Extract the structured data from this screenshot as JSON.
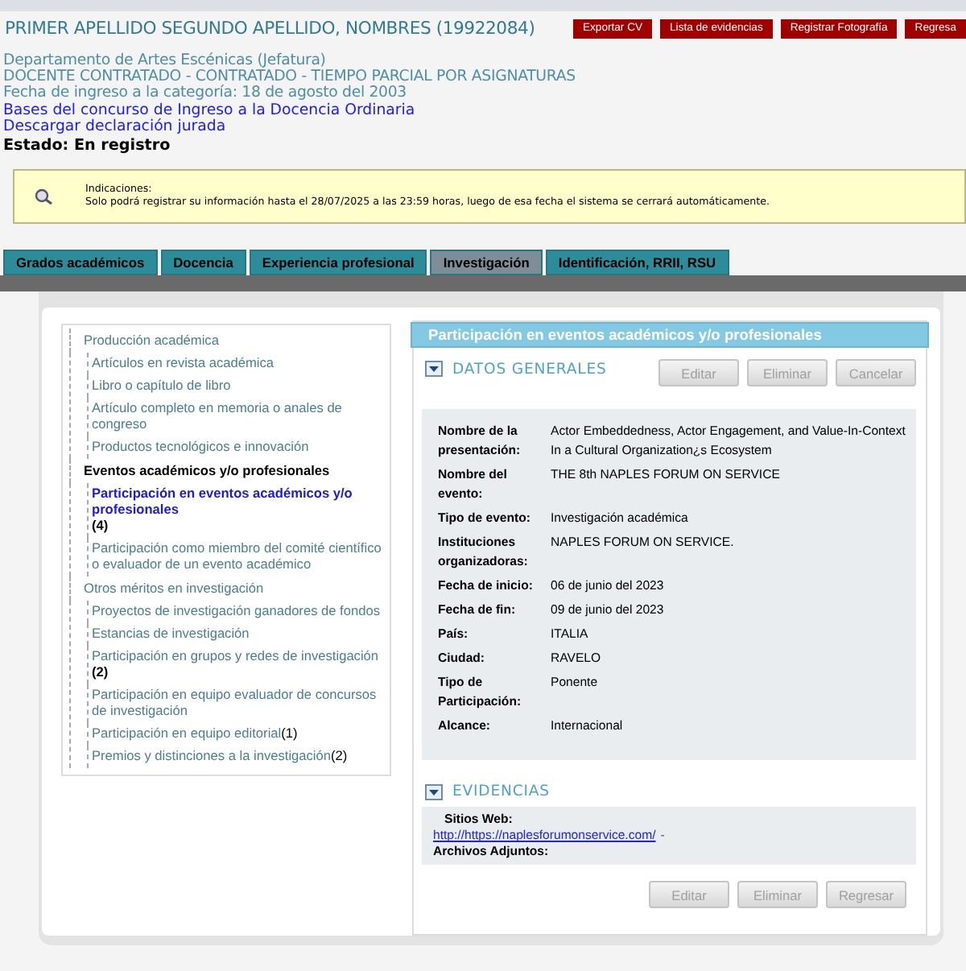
{
  "header": {
    "title": "PRIMER APELLIDO SEGUNDO APELLIDO, NOMBRES (19922084)",
    "buttons": [
      "Exportar CV",
      "Lista de evidencias",
      "Registrar Fotografía",
      "Regresa"
    ]
  },
  "profile": {
    "lines": [
      "Departamento de Artes Escénicas (Jefatura)",
      "DOCENTE CONTRATADO - CONTRATADO - TIEMPO PARCIAL POR ASIGNATURAS",
      "Fecha de ingreso a la categoría: 18 de agosto del 2003"
    ],
    "links": [
      "Bases del concurso de Ingreso a la Docencia Ordinaria",
      "Descargar declaración jurada"
    ],
    "status": "Estado: En registro"
  },
  "notice": {
    "title": "Indicaciones:",
    "text": "Solo podrá registrar su información hasta el 28/07/2025 a las 23:59 horas, luego de esa fecha el sistema se cerrará automáticamente."
  },
  "tabs": [
    {
      "label": "Grados académicos",
      "selected": false
    },
    {
      "label": "Docencia",
      "selected": false
    },
    {
      "label": "Experiencia profesional",
      "selected": false
    },
    {
      "label": "Investigación",
      "selected": true
    },
    {
      "label": "Identificación, RRII, RSU",
      "selected": false
    }
  ],
  "tree": [
    {
      "label": "Producción académica",
      "selected": false,
      "children": [
        {
          "label": "Artículos en revista académica",
          "selected": false
        },
        {
          "label": "Libro o capítulo de libro",
          "selected": false
        },
        {
          "label": "Artículo completo en memoria o anales de congreso",
          "selected": false
        },
        {
          "label": "Productos tecnológicos e innovación",
          "selected": false
        }
      ]
    },
    {
      "label": "Eventos académicos y/o profesionales",
      "selected": true,
      "children": [
        {
          "label": "Participación en eventos académicos y/o profesionales",
          "count": "(4)",
          "kind": "count_below",
          "selected": true
        },
        {
          "label": "Participación como miembro del comité científico o evaluador de un evento académico",
          "selected": false
        }
      ]
    },
    {
      "label": "Otros méritos en investigación",
      "selected": false,
      "children": [
        {
          "label": "Proyectos de investigación ganadores de fondos",
          "selected": false
        },
        {
          "label": "Estancias de investigación",
          "selected": false
        },
        {
          "label": "Participación en grupos y redes de investigación",
          "count": "(2)",
          "kind": "count_below",
          "selected": false
        },
        {
          "label": "Participación en equipo evaluador de concursos de investigación",
          "selected": false
        },
        {
          "label": "Participación en equipo editorial",
          "count": "(1)",
          "kind": "count_inline",
          "selected": false
        },
        {
          "label": "Premios y distinciones a la investigación",
          "count": "(2)",
          "kind": "count_inline",
          "selected": false
        }
      ]
    }
  ],
  "detail": {
    "title": "Participación en eventos académicos y/o profesionales",
    "section": "DATOS GENERALES",
    "section_buttons": [
      "Editar",
      "Eliminar",
      "Cancelar"
    ],
    "fields": [
      {
        "label": "Nombre de la presentación:",
        "value": "Actor Embeddedness, Actor Engagement, and Value-In-Context In a Cultural Organization¿s Ecosystem"
      },
      {
        "label": "Nombre del evento:",
        "value": "THE 8th NAPLES FORUM ON SERVICE"
      },
      {
        "label": "Tipo de evento:",
        "value": "Investigación académica"
      },
      {
        "label": "Instituciones organizadoras:",
        "value": "NAPLES FORUM ON SERVICE."
      },
      {
        "label": "Fecha de inicio:",
        "value": "06 de junio del 2023"
      },
      {
        "label": "Fecha de fin:",
        "value": "09 de junio del 2023"
      },
      {
        "label": "País:",
        "value": "ITALIA"
      },
      {
        "label": "Ciudad:",
        "value": "RAVELO"
      },
      {
        "label": "Tipo de Participación:",
        "value": "Ponente"
      },
      {
        "label": "Alcance:",
        "value": "Internacional"
      }
    ],
    "evidence_section": "EVIDENCIAS",
    "websites_label": "Sitios Web:",
    "website": "http://https://naplesforumonservice.com/",
    "website_sep": "-",
    "attachments_label": "Archivos Adjuntos:",
    "bottom_buttons": [
      "Editar",
      "Eliminar",
      "Regresar"
    ]
  }
}
